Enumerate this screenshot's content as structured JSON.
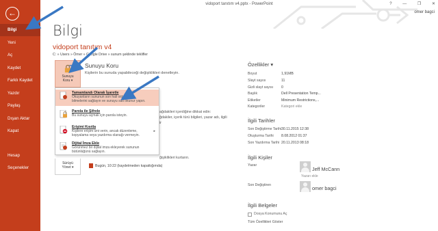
{
  "window": {
    "title": "vidoport tanıtım v4.pptx - PowerPoint",
    "help": "?",
    "minimize": "—",
    "restore": "❐",
    "close": "✕",
    "user": "omer bagci"
  },
  "sidebar": {
    "back": "←",
    "items": [
      {
        "label": "Bilgi"
      },
      {
        "label": "Yeni"
      },
      {
        "label": "Aç"
      },
      {
        "label": "Kaydet"
      },
      {
        "label": "Farklı Kaydet"
      },
      {
        "label": "Yazdır"
      },
      {
        "label": "Paylaş"
      },
      {
        "label": "Dışarı Aktar"
      },
      {
        "label": "Kapat"
      },
      {
        "label": "Hesap"
      },
      {
        "label": "Seçenekler"
      }
    ]
  },
  "main": {
    "page_title": "Bilgi",
    "doc_title": "vidoport tanıtım v4",
    "doc_path": "C: » Users » Ömer » Google Drive » sunum şeklinde teklifler",
    "protect": {
      "button_line1": "Sunuyu",
      "button_line2": "Koru ▾",
      "heading": "Sunuyu Koru",
      "description": "Kişilerin bu sunuda yapabileceği değişiklikleri denetleyin."
    },
    "inspect_lines": [
      "ağdakileri içerdiğine dikkat edin:",
      "ğdakiler, içerik türü bilgileri, yazar adı, ilgili",
      "ir"
    ],
    "versions": {
      "description": "ğişiklikleri kurtarın.",
      "button_line1": "Sürüyü",
      "button_line2": "Yönet ▾",
      "entry": "Bugün, 10:22 (kaydetmeden kapattığımda)"
    }
  },
  "dropdown": {
    "items": [
      {
        "title": "Tamamlandı Olarak İşaretle",
        "desc": [
          "Okuyanların sununun son hali olduğunu",
          "bilmelerini sağlayın ve sunuyu salt okunur yapın."
        ]
      },
      {
        "title": "Parola ile Şifrele",
        "desc": [
          "Bu sunuyu açmak için parola isteyin."
        ]
      },
      {
        "title": "Erişimi Kısıtla",
        "desc": [
          "Kişilere erişim izni verin, ancak düzenleme,",
          "kopyalama veya yazdırma olanağı vermeyin."
        ]
      },
      {
        "title": "Dijital İmza Ekle",
        "desc": [
          "Görünmez bir dijital imza ekleyerek sununun",
          "bütünlüğünü sağlayın."
        ]
      }
    ],
    "submenu_arrow": "▸"
  },
  "properties": {
    "title": "Özellikler ▾",
    "rows": [
      {
        "k": "Boyut",
        "v": "1,91MB"
      },
      {
        "k": "Slayt sayısı",
        "v": "11"
      },
      {
        "k": "Gizli slayt sayısı",
        "v": "0"
      },
      {
        "k": "Başlık",
        "v": "Dell Presentation Temp..."
      },
      {
        "k": "Etiketler",
        "v": "Minimum Restrictions,..."
      },
      {
        "k": "Kategoriler",
        "v": "Kategori ekle"
      }
    ]
  },
  "dates": {
    "title": "İlgili Tarihler",
    "rows": [
      {
        "k": "Son Değiştirme Tarihi",
        "v": "30.11.2015 12:38"
      },
      {
        "k": "Oluşturma Tarihi",
        "v": "8.08.2012 01:37"
      },
      {
        "k": "Son Yazdırma Tarihi",
        "v": "20.11.2013 08:18"
      }
    ]
  },
  "people": {
    "title": "İlgili Kişiler",
    "author_label": "Yazar",
    "author_name": "Jeff McCann",
    "add_author": "Yazarı ekle",
    "modified_label": "Son Değiştiren",
    "modified_name": "omer bagci"
  },
  "documents": {
    "title": "İlgili Belgeler",
    "open_location": "Dosya Konumunu Aç",
    "show_all": "Tüm Özellikleri Göster"
  },
  "colors": {
    "accent": "#c43e1c",
    "accent_dark": "#a4331a",
    "highlight": "#f7cdbd",
    "arrow": "#3a78c3"
  }
}
